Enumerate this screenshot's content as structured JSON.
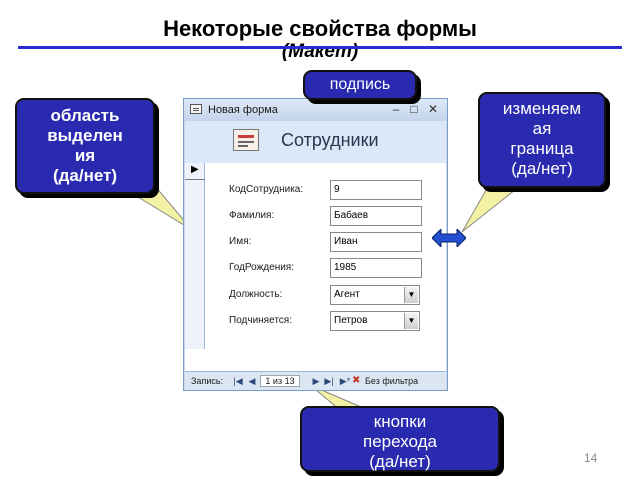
{
  "slide": {
    "title": "Некоторые свойства формы",
    "subtitle": "(Макет)",
    "page_number": "14"
  },
  "window": {
    "title": "Новая форма",
    "header_caption": "Сотрудники",
    "controls": [
      "minimize-icon",
      "maximize-icon",
      "close-icon"
    ]
  },
  "form_fields": [
    {
      "label": "КодСотрудника:",
      "value": "9"
    },
    {
      "label": "Фамилия:",
      "value": "Бабаев"
    },
    {
      "label": "Имя:",
      "value": "Иван"
    },
    {
      "label": "ГодРождения:",
      "value": "1985"
    },
    {
      "label": "Должность:",
      "value": "Агент"
    },
    {
      "label": "Подчиняется:",
      "value": "Петров"
    }
  ],
  "navigation": {
    "label": "Запись:",
    "first": "|◀",
    "prev": "◀",
    "counter": "1 из 13",
    "next": "▶",
    "last": "▶|",
    "new": "▶*",
    "filter": "Без фильтра"
  },
  "callouts": {
    "selection_area": [
      "область",
      "выделен",
      "ия",
      "(да/нет)"
    ],
    "caption": "подпись",
    "resizable_border": [
      "изменяем",
      "ая",
      "граница",
      "(да/нет)"
    ],
    "nav_buttons": [
      "кнопки",
      "перехода",
      "(да/нет)"
    ]
  },
  "colors": {
    "callout_fill": "#2a2ab0",
    "title_rule": "#2b2bd6",
    "pointer_fill": "#f3f1a3",
    "arrow_fill": "#2250d0"
  }
}
